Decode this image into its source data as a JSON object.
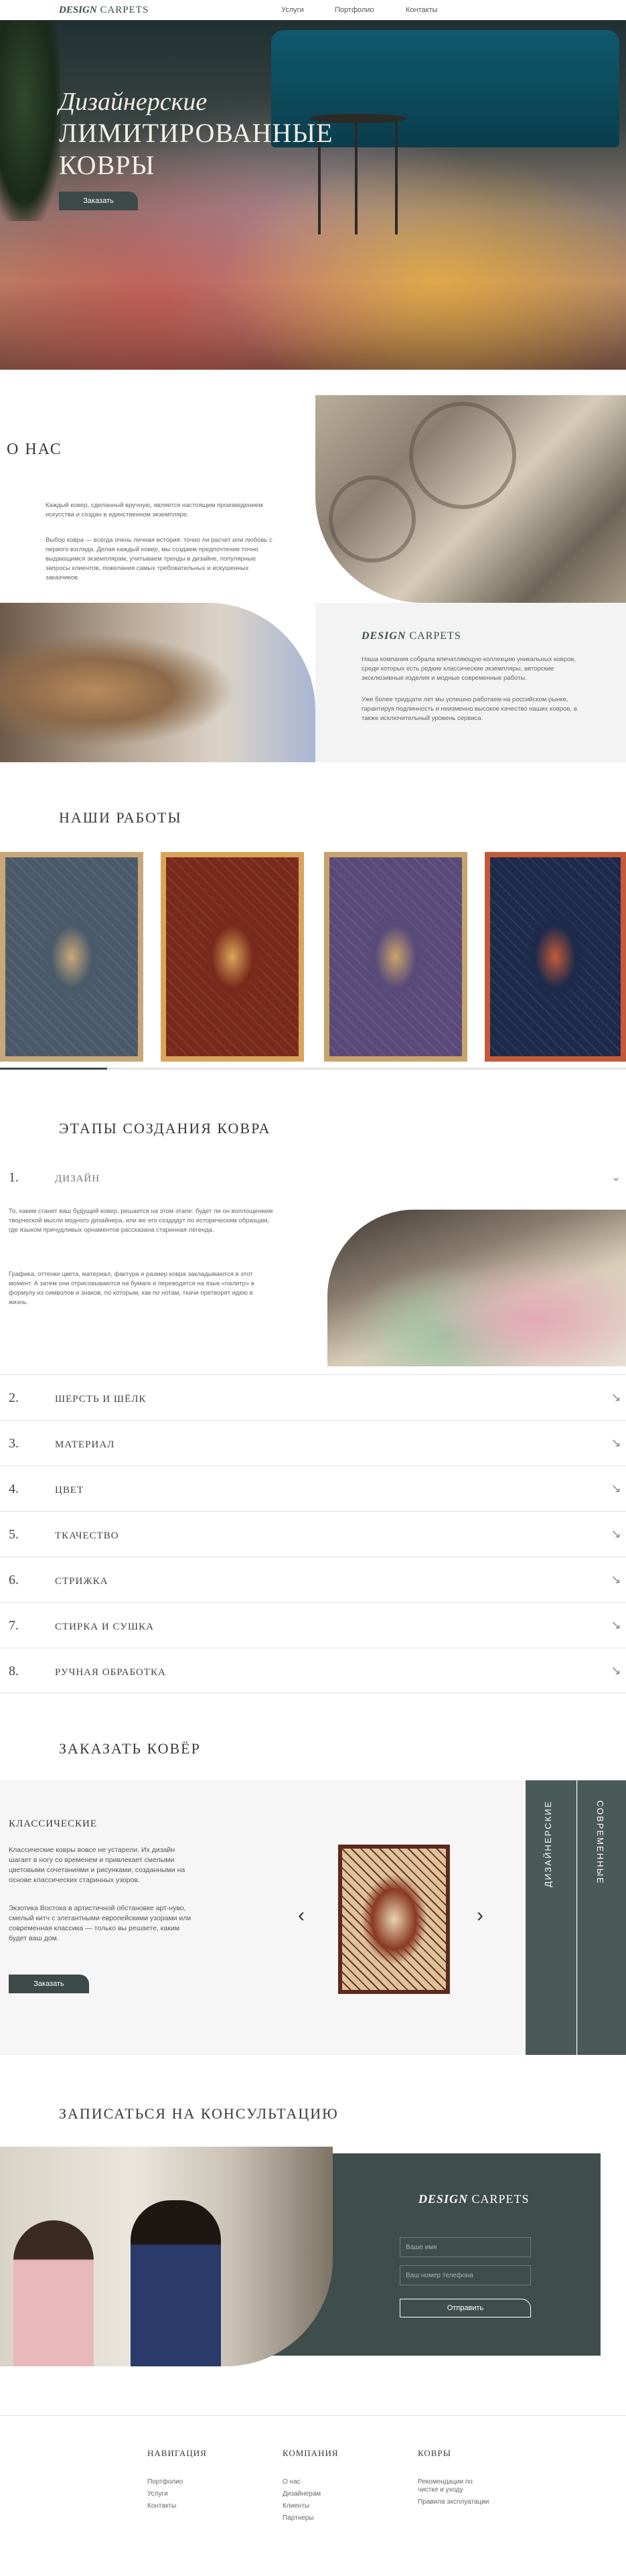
{
  "header": {
    "logo_mark": "DESIGN",
    "logo_text": "CARPETS",
    "nav": [
      "Услуги",
      "Портфолио",
      "Контакты"
    ]
  },
  "hero": {
    "title_italic": "Дизайнерские",
    "title_line1": "ЛИМИТИРОВАННЫЕ",
    "title_line2": "КОВРЫ",
    "button": "Заказать"
  },
  "about": {
    "title": "О НАС",
    "paragraph1": "Каждый ковер, сделанный вручную, является настоящим произведением искусства и создан в единственном экземпляре.",
    "paragraph2": "Выбор ковра — всегда очень личная история: точно ли расчет или любовь с первого взгляда. Делая каждый ковер, мы создаем предпочтение точно выдающимся экземплярам, учитываем тренды в дизайне, популярные запросы клиентов, пожелания самых требовательных и искушенных заказчиков.",
    "logo_mark": "DESIGN",
    "logo_text": "CARPETS",
    "right_paragraph1": "Наша компания собрала впечатляющую коллекцию уникальных ковров, среди которых есть редкие классические экземпляры, авторские эксклюзивные изделия и модные современные работы.",
    "right_paragraph2": "Уже более тридцати лет мы успешно работаем на российском рынке, гарантируя подлинность и неизменно высокое качество наших ковров, а также исключительный уровень сервиса."
  },
  "works": {
    "title": "НАШИ РАБОТЫ",
    "rugs": [
      {
        "name": "rug-1",
        "base": "#4a5a6a",
        "accent": "#c8a878"
      },
      {
        "name": "rug-2",
        "base": "#7a2a1c",
        "accent": "#d9a45a"
      },
      {
        "name": "rug-3",
        "base": "#5a4a7a",
        "accent": "#c9a46a"
      },
      {
        "name": "rug-4",
        "base": "#1e2a4a",
        "accent": "#c45a3a"
      }
    ]
  },
  "stages": {
    "title": "ЭТАПЫ СОЗДАНИЯ КОВРА",
    "items": [
      {
        "num": "1.",
        "label": "ДИЗАЙН"
      },
      {
        "num": "2.",
        "label": "ШЕРСТЬ И ШЁЛК"
      },
      {
        "num": "3.",
        "label": "МАТЕРИАЛ"
      },
      {
        "num": "4.",
        "label": "ЦВЕТ"
      },
      {
        "num": "5.",
        "label": "ТКАЧЕСТВО"
      },
      {
        "num": "6.",
        "label": "СТРИЖКА"
      },
      {
        "num": "7.",
        "label": "СТИРКА И СУШКА"
      },
      {
        "num": "8.",
        "label": "РУЧНАЯ ОБРАБОТКА"
      }
    ],
    "design_text1": "То, каким станет ваш будущий ковер, решается на этом этапе: будет ли он воплощением творческой мысли модного дизайнера, или же его создадут по историческим образцам, где языком причудливых орнаментов рассказана старинная легенда.",
    "design_text2": "Графика, оттенки цвета, материал, фактура и размер ковра закладываются в этот момент. А затем они отрисовываются на бумаге и переводятся на язык «палитр» в формулу из символов и знаков, по которым, как по нотам, ткачи претворят идею в жизнь."
  },
  "order": {
    "title": "ЗАКАЗАТЬ КОВЁР",
    "subtitle": "КЛАССИЧЕСКИЕ",
    "text1": "Классические ковры вовсе не устарели. Их дизайн шагает в ногу со временем и привлекает смелыми цветовыми сочетаниями и рисунками, созданными на основе классических старинных узоров.",
    "text2": "Экзотика Востока в артистичной обстановке арт-нуво, смелый китч с элегантными европейскими узорами или современная классика — только вы решаете, каким будет ваш дом.",
    "button": "Заказать",
    "prev": "‹",
    "next": "›",
    "tabs": [
      "ДИЗАЙНЕРСКИЕ",
      "СОВРЕМЕННЫЕ"
    ]
  },
  "consult": {
    "title": "ЗАПИСАТЬСЯ НА КОНСУЛЬТАЦИЮ",
    "logo_mark": "DESIGN",
    "logo_text": "CARPETS",
    "name_placeholder": "Ваше имя",
    "phone_placeholder": "Ваш номер телефона",
    "button": "Отправить"
  },
  "footer": {
    "columns": [
      {
        "title": "НАВИГАЦИЯ",
        "links": [
          "Портфолио",
          "Услуги",
          "Контакты"
        ]
      },
      {
        "title": "КОМПАНИЯ",
        "links": [
          "О нас",
          "Дизайнерам",
          "Клиенты",
          "Партнеры"
        ]
      },
      {
        "title": "КОВРЫ",
        "links": [
          "Рекомендации по чистке и уходу",
          "Правила эксплуатации"
        ]
      }
    ]
  }
}
